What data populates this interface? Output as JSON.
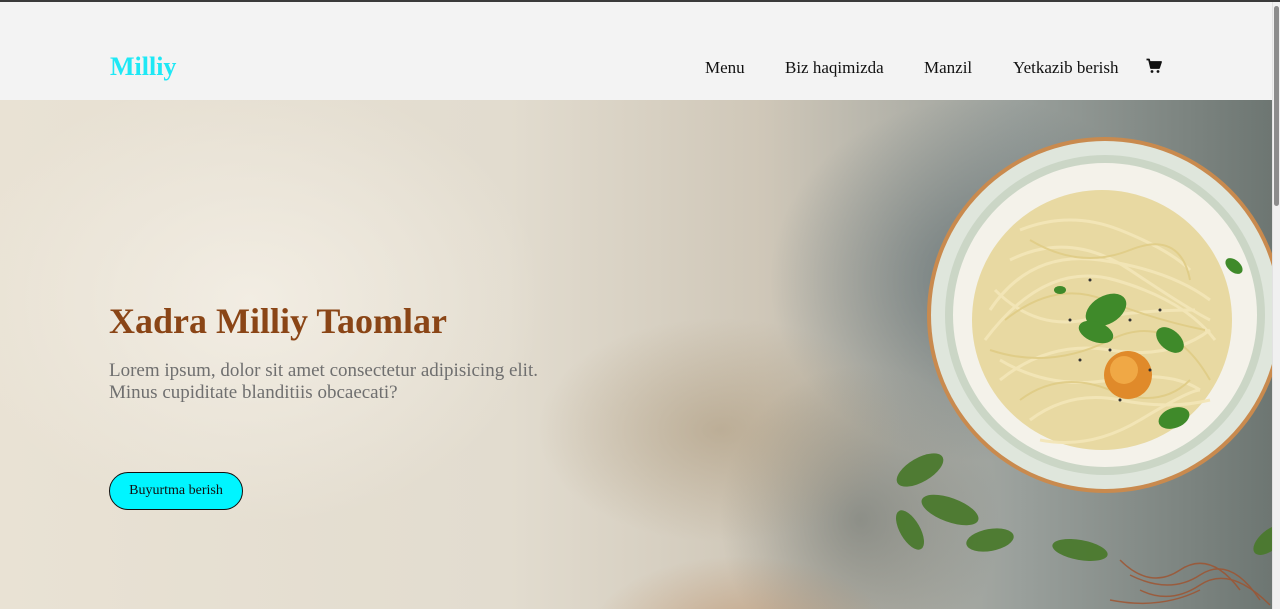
{
  "header": {
    "logo": "Milliy",
    "nav": [
      {
        "label": "Menu"
      },
      {
        "label": "Biz haqimizda"
      },
      {
        "label": "Manzil"
      },
      {
        "label": "Yetkazib berish"
      }
    ],
    "cart_icon": "cart-icon"
  },
  "hero": {
    "title": "Xadra Milliy Taomlar",
    "description": "Lorem ipsum, dolor sit amet consectetur adipisicing elit. Minus cupiditate blanditiis obcaecati?",
    "cta_label": "Buyurtma berish",
    "image": "noodle-soup-bowl"
  },
  "colors": {
    "logo": "#1ee8f5",
    "title": "#8a4516",
    "cta_bg": "#00f5ff",
    "header_bg": "#f3f3f3"
  }
}
